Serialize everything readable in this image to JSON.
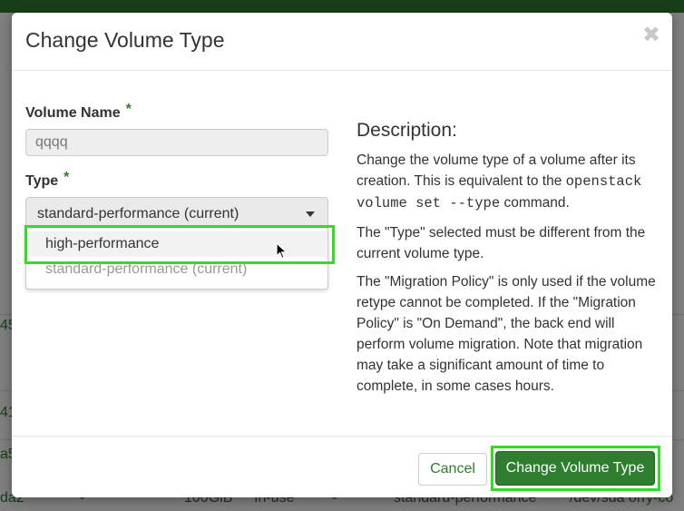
{
  "background": {
    "fragments": [
      "45",
      "41",
      "a5",
      "da2",
      "-",
      "100GiB",
      "In-use",
      "-",
      "standard-performance",
      "/dev/sda on",
      "y-co"
    ]
  },
  "modal": {
    "title": "Change Volume Type",
    "close_symbol": "✖",
    "volume_name": {
      "label": "Volume Name",
      "required_mark": "*",
      "value": "qqqq"
    },
    "type": {
      "label": "Type",
      "required_mark": "*",
      "selected": "standard-performance (current)",
      "options": [
        "high-performance",
        "standard-performance (current)"
      ]
    },
    "description": {
      "title": "Description:",
      "p1_before": "Change the volume type of a volume after its creation. This is equivalent to the ",
      "p1_code": "openstack volume set --type",
      "p1_after": " command.",
      "p2": "The \"Type\" selected must be different from the current volume type.",
      "p3": "The \"Migration Policy\" is only used if the volume retype cannot be completed. If the \"Migration Policy\" is \"On Demand\", the back end will perform volume migration. Note that migration may take a significant amount of time to complete, in some cases hours."
    },
    "footer": {
      "cancel_label": "Cancel",
      "submit_label": "Change Volume Type"
    }
  },
  "colors": {
    "brand_green": "#2f7d2f",
    "highlight": "#33dd22"
  }
}
